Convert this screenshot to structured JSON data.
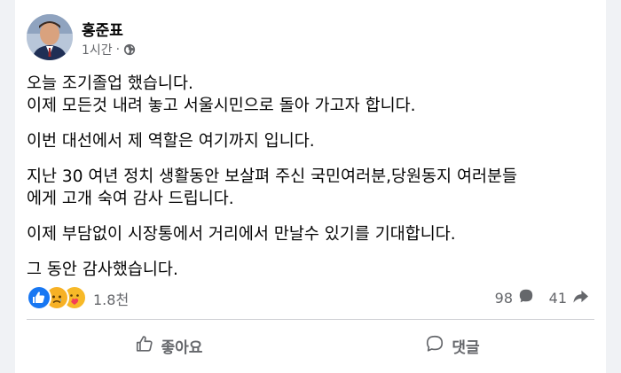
{
  "post": {
    "author": "홍준표",
    "time": "1시간",
    "separator": "·",
    "paragraphs": [
      [
        "오늘 조기졸업 했습니다.",
        "이제 모든것 내려 놓고 서울시민으로 돌아 가고자 합니다."
      ],
      [
        "이번 대선에서 제 역할은 여기까지 입니다."
      ],
      [
        "지난 30 여년 정치 생활동안 보살펴 주신 국민여러분,당원동지 여러분들",
        "에게 고개 숙여 감사 드립니다."
      ],
      [
        "이제 부담없이 시장통에서 거리에서 만날수 있기를 기대합니다."
      ],
      [
        "그 동안 감사했습니다."
      ]
    ]
  },
  "stats": {
    "reaction_count": "1.8천",
    "comment_count": "98",
    "share_count": "41"
  },
  "actions": {
    "like_label": "좋아요",
    "comment_label": "댓글"
  },
  "colors": {
    "like_blue": "#1877f2",
    "sad_yellow": "#f7b125",
    "care_yellow": "#f7b928",
    "secondary_text": "#65676b"
  },
  "icons": {
    "privacy": "globe-icon",
    "reactions": [
      "like-reaction-icon",
      "sad-reaction-icon",
      "care-reaction-icon"
    ],
    "comment_stat": "comment-bubble-icon",
    "share_stat": "share-arrow-icon",
    "like_action": "thumbs-up-icon",
    "comment_action": "comment-icon"
  }
}
